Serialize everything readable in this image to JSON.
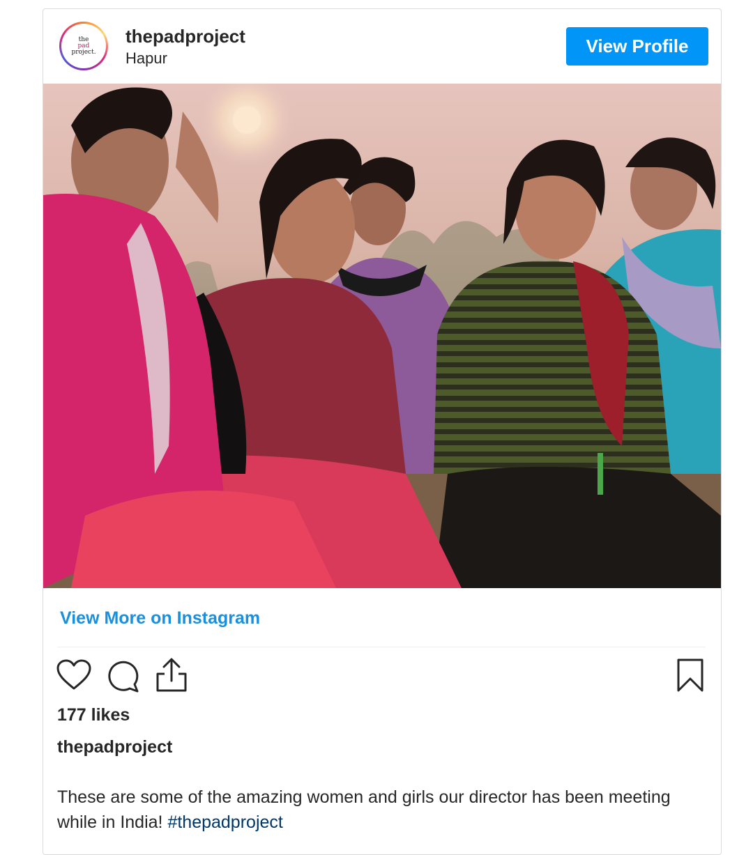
{
  "post": {
    "username": "thepadproject",
    "location": "Hapur",
    "avatar_text": [
      "the",
      "pad",
      "project."
    ],
    "view_profile_label": "View Profile",
    "view_more_label": "View More on Instagram",
    "likes": "177 likes",
    "caption_username": "thepadproject",
    "caption_text": "These are some of the amazing women and girls our director has been meeting while in India! ",
    "caption_hashtag": "#thepadproject"
  },
  "icons": {
    "like": "heart-icon",
    "comment": "comment-icon",
    "share": "share-icon",
    "save": "bookmark-icon"
  },
  "colors": {
    "accent": "#0095f6",
    "link": "#1a8fdd",
    "hashtag": "#00376b",
    "text": "#262626",
    "border": "#dbdbdb"
  }
}
